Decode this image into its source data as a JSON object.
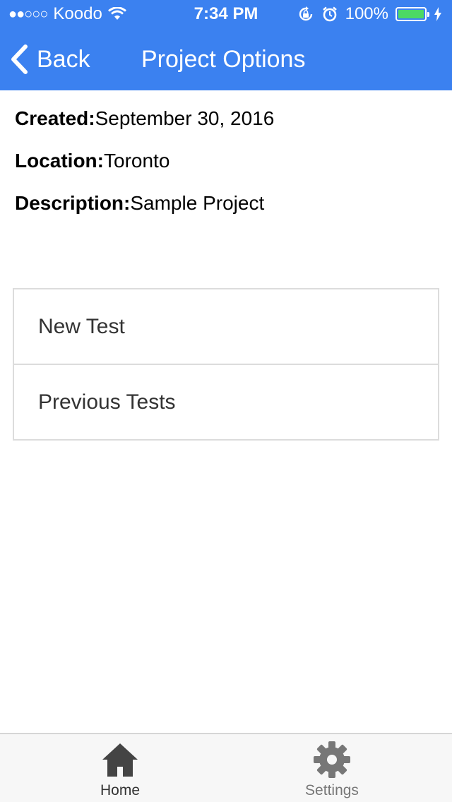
{
  "status_bar": {
    "signal": "●●○○○",
    "carrier": "Koodo",
    "time": "7:34 PM",
    "battery": "100%",
    "battery_level": 1.0
  },
  "nav": {
    "back_label": "Back",
    "title": "Project Options"
  },
  "project": {
    "created_label": "Created:",
    "created_value": "September 30, 2016",
    "location_label": "Location:",
    "location_value": "Toronto",
    "description_label": "Description:",
    "description_value": "Sample Project"
  },
  "options": [
    {
      "label": "New Test"
    },
    {
      "label": "Previous Tests"
    }
  ],
  "tabs": [
    {
      "label": "Home",
      "icon": "home-icon",
      "selected": true
    },
    {
      "label": "Settings",
      "icon": "gear-icon",
      "selected": false
    }
  ],
  "colors": {
    "nav_bg": "#3b81f0",
    "battery_fill": "#4cd964",
    "tab_selected": "#444444",
    "tab_unselected": "#777777"
  }
}
